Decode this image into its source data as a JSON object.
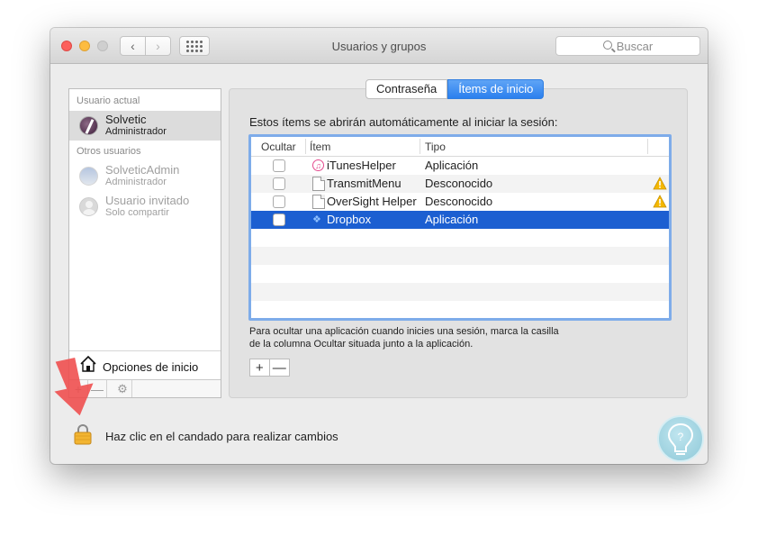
{
  "window": {
    "title": "Usuarios y grupos",
    "search_placeholder": "Buscar"
  },
  "sidebar": {
    "current_user_label": "Usuario actual",
    "current_user": {
      "name": "Solvetic",
      "role": "Administrador"
    },
    "other_users_label": "Otros usuarios",
    "other_users": [
      {
        "name": "SolveticAdmin",
        "role": "Administrador"
      },
      {
        "name": "Usuario invitado",
        "role": "Solo compartir"
      }
    ],
    "login_options_label": "Opciones de inicio",
    "add_label": "+",
    "remove_label": "—",
    "gear_glyph": "⚙"
  },
  "tabs": {
    "password": "Contraseña",
    "login_items": "Ítems de inicio"
  },
  "login_items": {
    "description": "Estos ítems se abrirán automáticamente al iniciar la sesión:",
    "columns": {
      "hide": "Ocultar",
      "item": "Ítem",
      "type": "Tipo"
    },
    "rows": [
      {
        "name": "iTunesHelper",
        "type": "Aplicación",
        "hidden": false,
        "icon": "itunes-icon",
        "warning": false
      },
      {
        "name": "TransmitMenu",
        "type": "Desconocido",
        "hidden": false,
        "icon": "document-icon",
        "warning": true
      },
      {
        "name": "OverSight Helper",
        "type": "Desconocido",
        "hidden": false,
        "icon": "document-icon",
        "warning": true
      },
      {
        "name": "Dropbox",
        "type": "Aplicación",
        "hidden": false,
        "icon": "dropbox-icon",
        "warning": false,
        "selected": true
      }
    ],
    "hint_line1": "Para ocultar una aplicación cuando inicies una sesión, marca la casilla",
    "hint_line2": "de la columna Ocultar situada junto a la aplicación.",
    "add_label": "+",
    "remove_label": "—"
  },
  "lock": {
    "text": "Haz clic en el candado para realizar cambios"
  },
  "colors": {
    "selection_blue": "#1c5fd1",
    "tab_active": "#2b80ee",
    "warning": "#f5b800",
    "arrow_red": "#ef4b4b"
  }
}
